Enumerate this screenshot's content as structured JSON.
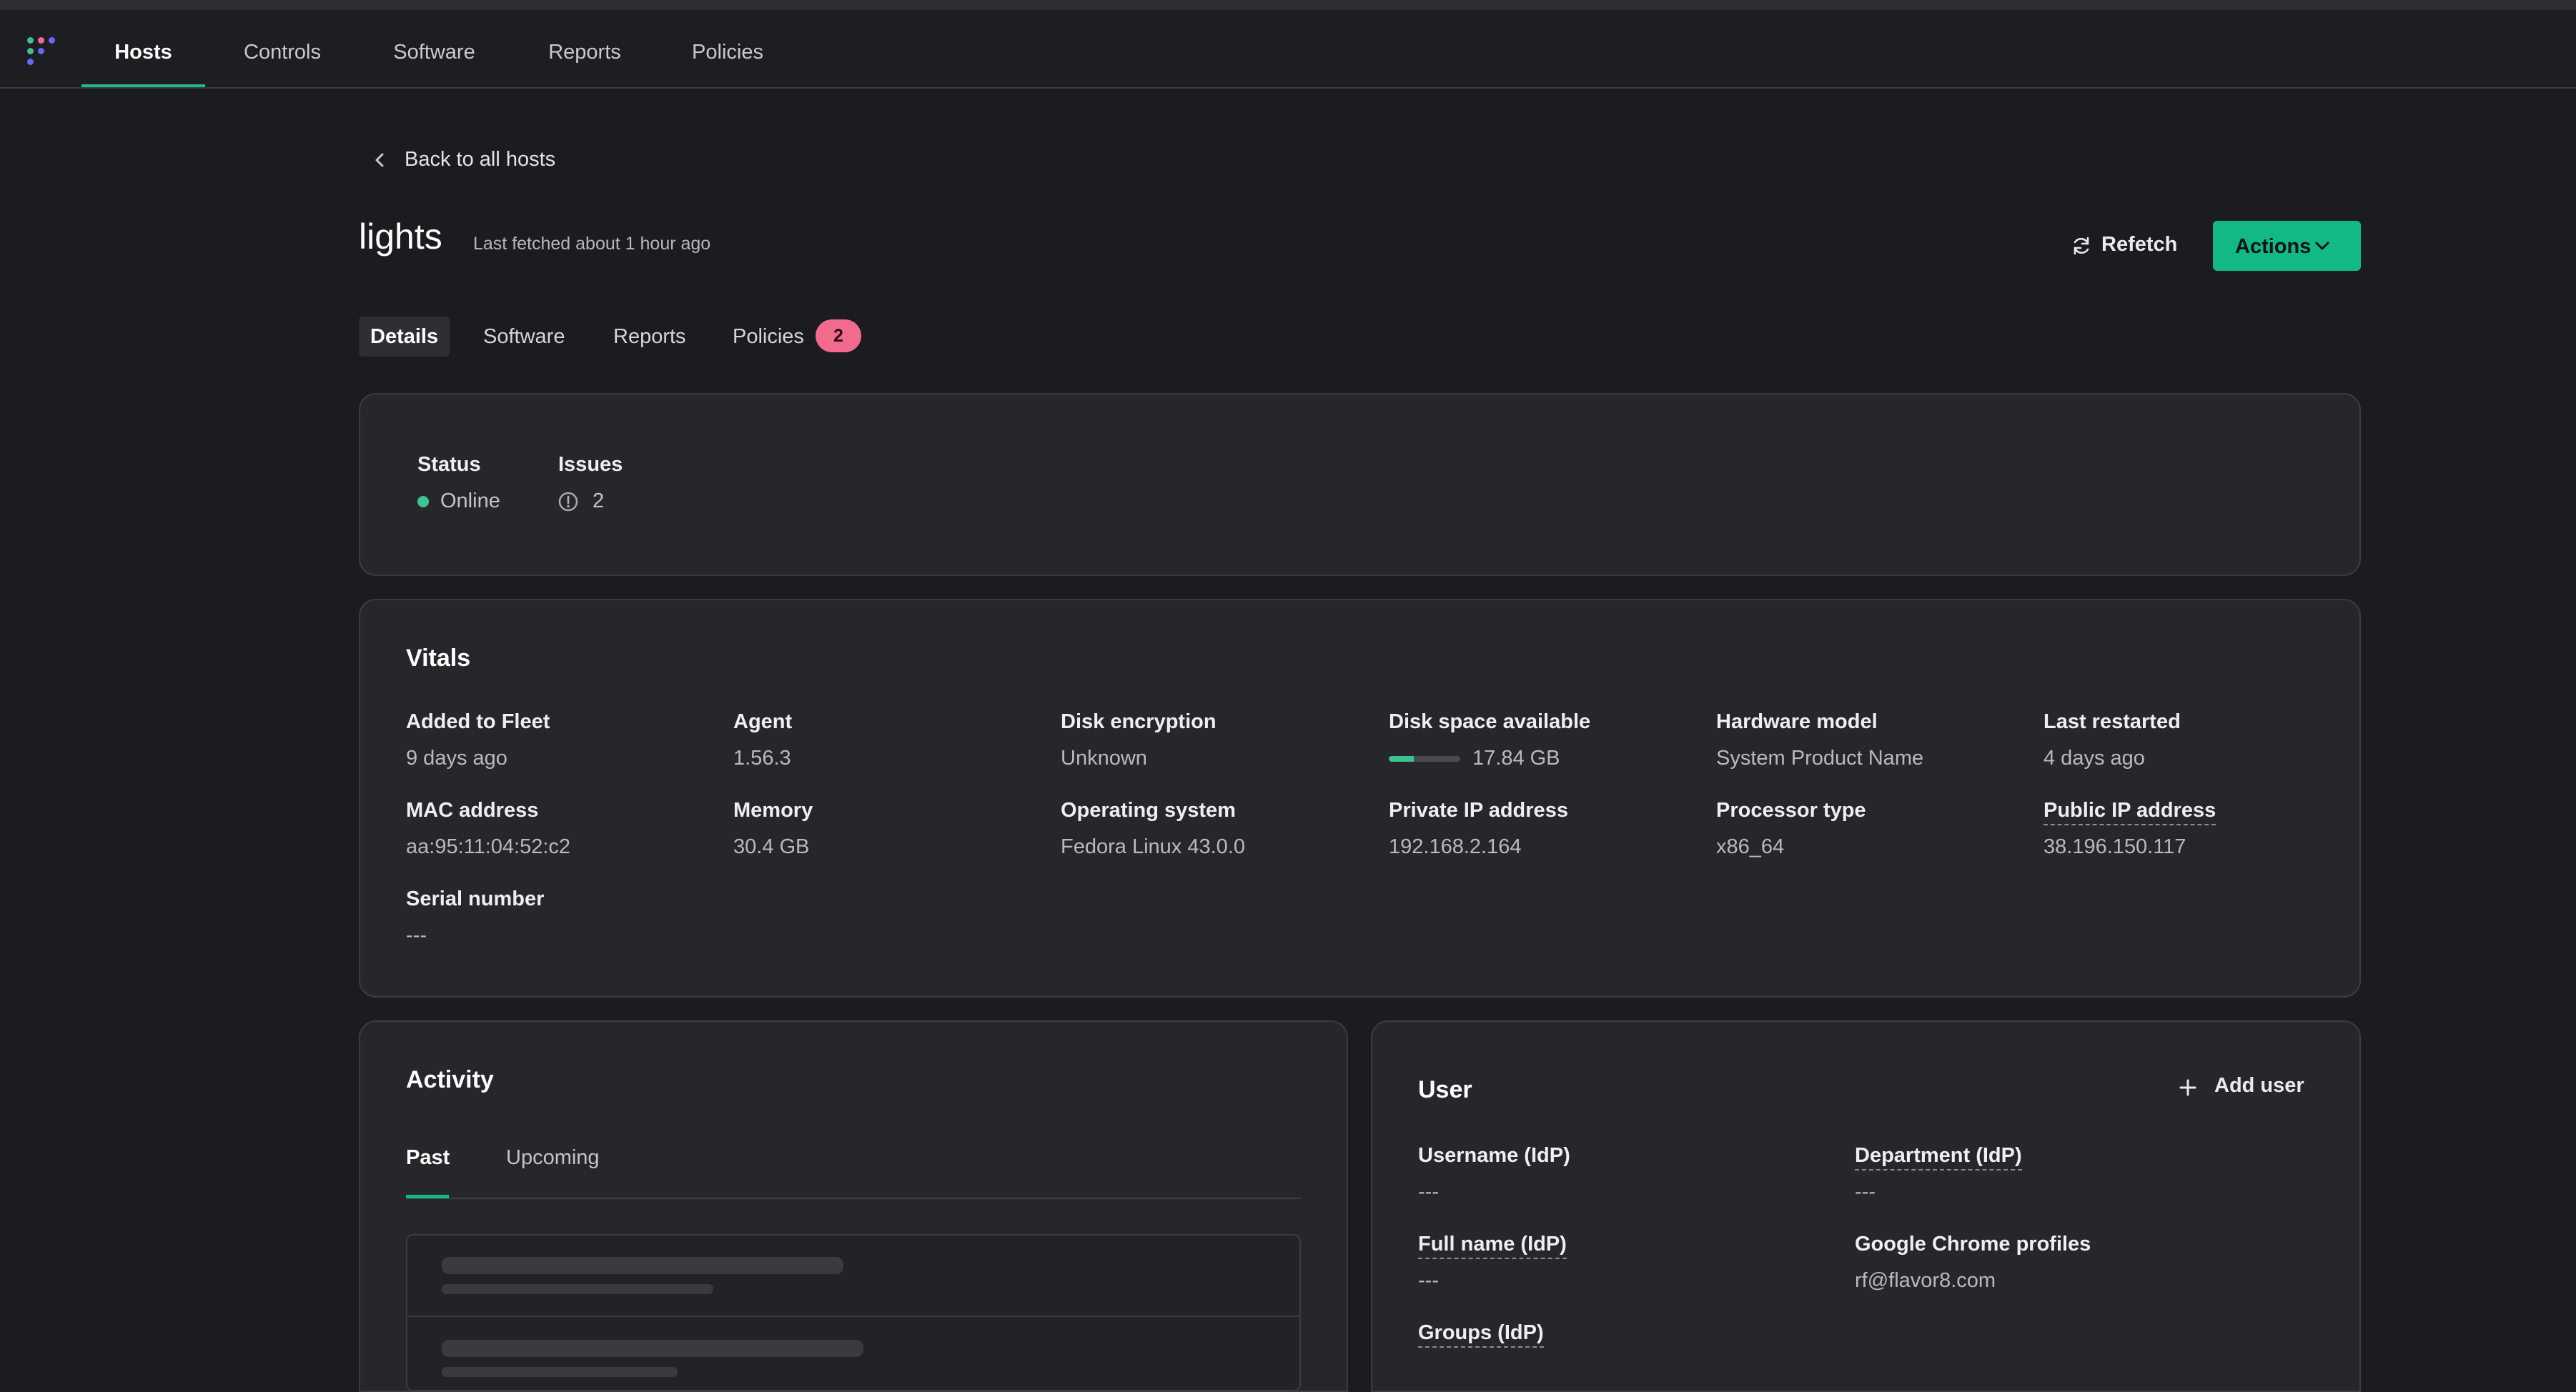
{
  "nav": {
    "items": [
      "Hosts",
      "Controls",
      "Software",
      "Reports",
      "Policies"
    ],
    "active": "Hosts"
  },
  "back_link": "Back to all hosts",
  "host": {
    "name": "lights",
    "last_fetched": "Last fetched about 1 hour ago"
  },
  "buttons": {
    "refetch": "Refetch",
    "actions": "Actions"
  },
  "tabs": {
    "details": "Details",
    "software": "Software",
    "reports": "Reports",
    "policies": "Policies",
    "policies_count": "2"
  },
  "summary": {
    "status_label": "Status",
    "status_value": "Online",
    "issues_label": "Issues",
    "issues_value": "2"
  },
  "vitals": {
    "title": "Vitals",
    "added_label": "Added to Fleet",
    "added_value": "9 days ago",
    "agent_label": "Agent",
    "agent_value": "1.56.3",
    "disk_enc_label": "Disk encryption",
    "disk_enc_value": "Unknown",
    "disk_space_label": "Disk space available",
    "disk_space_value": "17.84 GB",
    "disk_fill_fraction": 0.35,
    "hw_label": "Hardware model",
    "hw_value": "System Product Name",
    "restarted_label": "Last restarted",
    "restarted_value": "4 days ago",
    "mac_label": "MAC address",
    "mac_value": "aa:95:11:04:52:c2",
    "memory_label": "Memory",
    "memory_value": "30.4 GB",
    "os_label": "Operating system",
    "os_value": "Fedora Linux 43.0.0",
    "private_ip_label": "Private IP address",
    "private_ip_value": "192.168.2.164",
    "cpu_label": "Processor type",
    "cpu_value": "x86_64",
    "public_ip_label": "Public IP address",
    "public_ip_value": "38.196.150.117",
    "serial_label": "Serial number",
    "serial_value": "---"
  },
  "activity": {
    "title": "Activity",
    "tab_past": "Past",
    "tab_upcoming": "Upcoming"
  },
  "user": {
    "title": "User",
    "add_user": "Add user",
    "username_label": "Username (IdP)",
    "username_value": "---",
    "department_label": "Department (IdP)",
    "department_value": "---",
    "fullname_label": "Full name (IdP)",
    "fullname_value": "---",
    "chrome_label": "Google Chrome profiles",
    "chrome_value": "rf@flavor8.com",
    "groups_label": "Groups (IdP)"
  },
  "colors": {
    "accent": "#12b886",
    "online": "#3ec28f",
    "badge": "#f26b8f",
    "background": "#1b1c1f",
    "card": "#26272b"
  }
}
